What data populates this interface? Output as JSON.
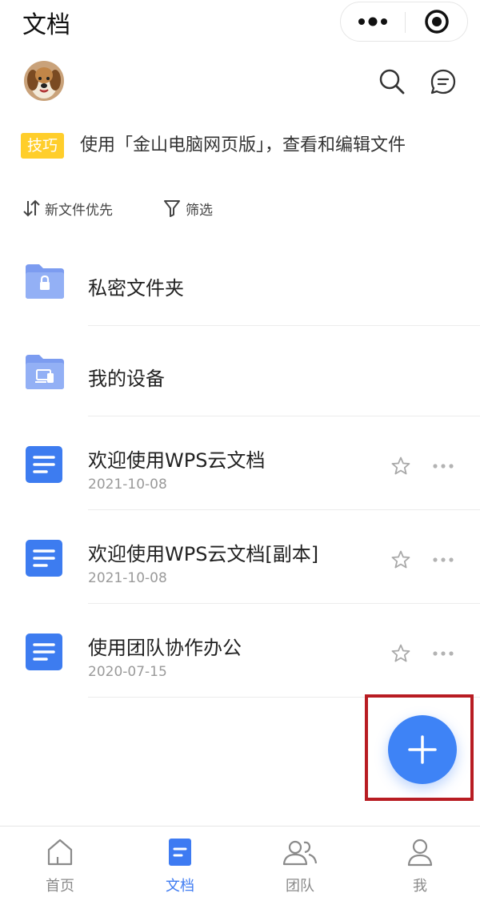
{
  "header": {
    "title": "文档"
  },
  "toolbar": {
    "tip_badge": "技巧",
    "tip_text": "使用「金山电脑网页版」，查看和编辑文件",
    "sort_label": "新文件优先",
    "filter_label": "筛选"
  },
  "folders": [
    {
      "name": "私密文件夹",
      "icon": "lock-folder-icon"
    },
    {
      "name": "我的设备",
      "icon": "device-folder-icon"
    }
  ],
  "files": [
    {
      "name": "欢迎使用WPS云文档",
      "date": "2021-10-08"
    },
    {
      "name": "欢迎使用WPS云文档[副本]",
      "date": "2021-10-08"
    },
    {
      "name": "使用团队协作办公",
      "date": "2020-07-15"
    }
  ],
  "tabs": [
    {
      "label": "首页",
      "icon": "home-icon",
      "active": false
    },
    {
      "label": "文档",
      "icon": "document-icon",
      "active": true
    },
    {
      "label": "团队",
      "icon": "team-icon",
      "active": false
    },
    {
      "label": "我",
      "icon": "user-icon",
      "active": false
    }
  ],
  "colors": {
    "accent": "#3e83f6",
    "tip_badge": "#ffce2b",
    "highlight_box": "#b81c22",
    "folder": "#7c9cf0",
    "doc": "#3d7cf0"
  }
}
